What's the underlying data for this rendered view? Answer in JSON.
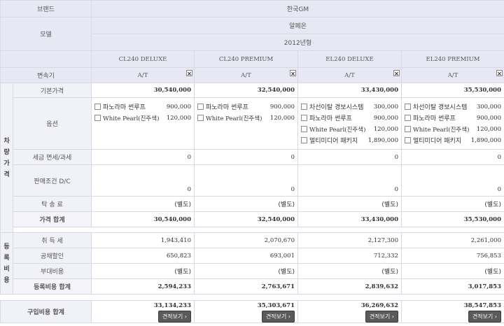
{
  "header": {
    "brand_label": "브랜드",
    "brand": "한국GM",
    "model_label": "모델",
    "model": "알페온",
    "year": "2012년형",
    "trans_label": "변속기"
  },
  "trims": [
    {
      "name": "CL240 DELUXE",
      "trans": "A/T",
      "base": "30,540,000",
      "tax": "0",
      "dc": "0",
      "ship": "(별도)",
      "subtotal": "30,540,000",
      "acq": "1,943,410",
      "bond": "650,823",
      "extra": "(별도)",
      "reg": "2,594,233",
      "total": "33,134,233",
      "options": [
        {
          "name": "파노라마 썬루프",
          "price": "900,000"
        },
        {
          "name": "White Pearl(진주색)",
          "price": "120,000"
        }
      ]
    },
    {
      "name": "CL240 PREMIUM",
      "trans": "A/T",
      "base": "32,540,000",
      "tax": "0",
      "dc": "0",
      "ship": "(별도)",
      "subtotal": "32,540,000",
      "acq": "2,070,670",
      "bond": "693,001",
      "extra": "(별도)",
      "reg": "2,763,671",
      "total": "35,303,671",
      "options": [
        {
          "name": "파노라마 썬루프",
          "price": "900,000"
        },
        {
          "name": "White Pearl(진주색)",
          "price": "120,000"
        }
      ]
    },
    {
      "name": "EL240 DELUXE",
      "trans": "A/T",
      "base": "33,430,000",
      "tax": "0",
      "dc": "0",
      "ship": "(별도)",
      "subtotal": "33,430,000",
      "acq": "2,127,300",
      "bond": "712,332",
      "extra": "(별도)",
      "reg": "2,839,632",
      "total": "36,269,632",
      "options": [
        {
          "name": "차선이탈 경보시스템",
          "price": "300,000"
        },
        {
          "name": "파노라마 썬루프",
          "price": "900,000"
        },
        {
          "name": "White Pearl(진주색)",
          "price": "120,000"
        },
        {
          "name": "멀티미디어 패키지",
          "price": "1,890,000"
        }
      ]
    },
    {
      "name": "EL240 PREMIUM",
      "trans": "A/T",
      "base": "35,530,000",
      "tax": "0",
      "dc": "0",
      "ship": "(별도)",
      "subtotal": "35,530,000",
      "acq": "2,261,000",
      "bond": "756,853",
      "extra": "(별도)",
      "reg": "3,017,853",
      "total": "38,547,853",
      "options": [
        {
          "name": "차선이탈 경보시스템",
          "price": "300,000"
        },
        {
          "name": "파노라마 썬루프",
          "price": "900,000"
        },
        {
          "name": "White Pearl(진주색)",
          "price": "120,000"
        },
        {
          "name": "멀티미디어 패키지",
          "price": "1,890,000"
        }
      ]
    }
  ],
  "labels": {
    "vehicle_price": "차량가격",
    "base_price": "기본가격",
    "options": "옵션",
    "tax": "세금 면세/과세",
    "dc": "판매조건 D/C",
    "ship": "탁 송 료",
    "subtotal": "가격 합계",
    "reg_cost": "등록비용",
    "acq": "취 득 세",
    "bond": "공채할인",
    "extra": "부대비용",
    "reg": "등록비용 합계",
    "total": "구입비용 합계",
    "estimate": "견적보기 ›",
    "close": "×"
  },
  "colors": {
    "header_bg": "#e8e8f4",
    "label_bg": "#f1f1f8",
    "border": "#d9d9e6"
  }
}
